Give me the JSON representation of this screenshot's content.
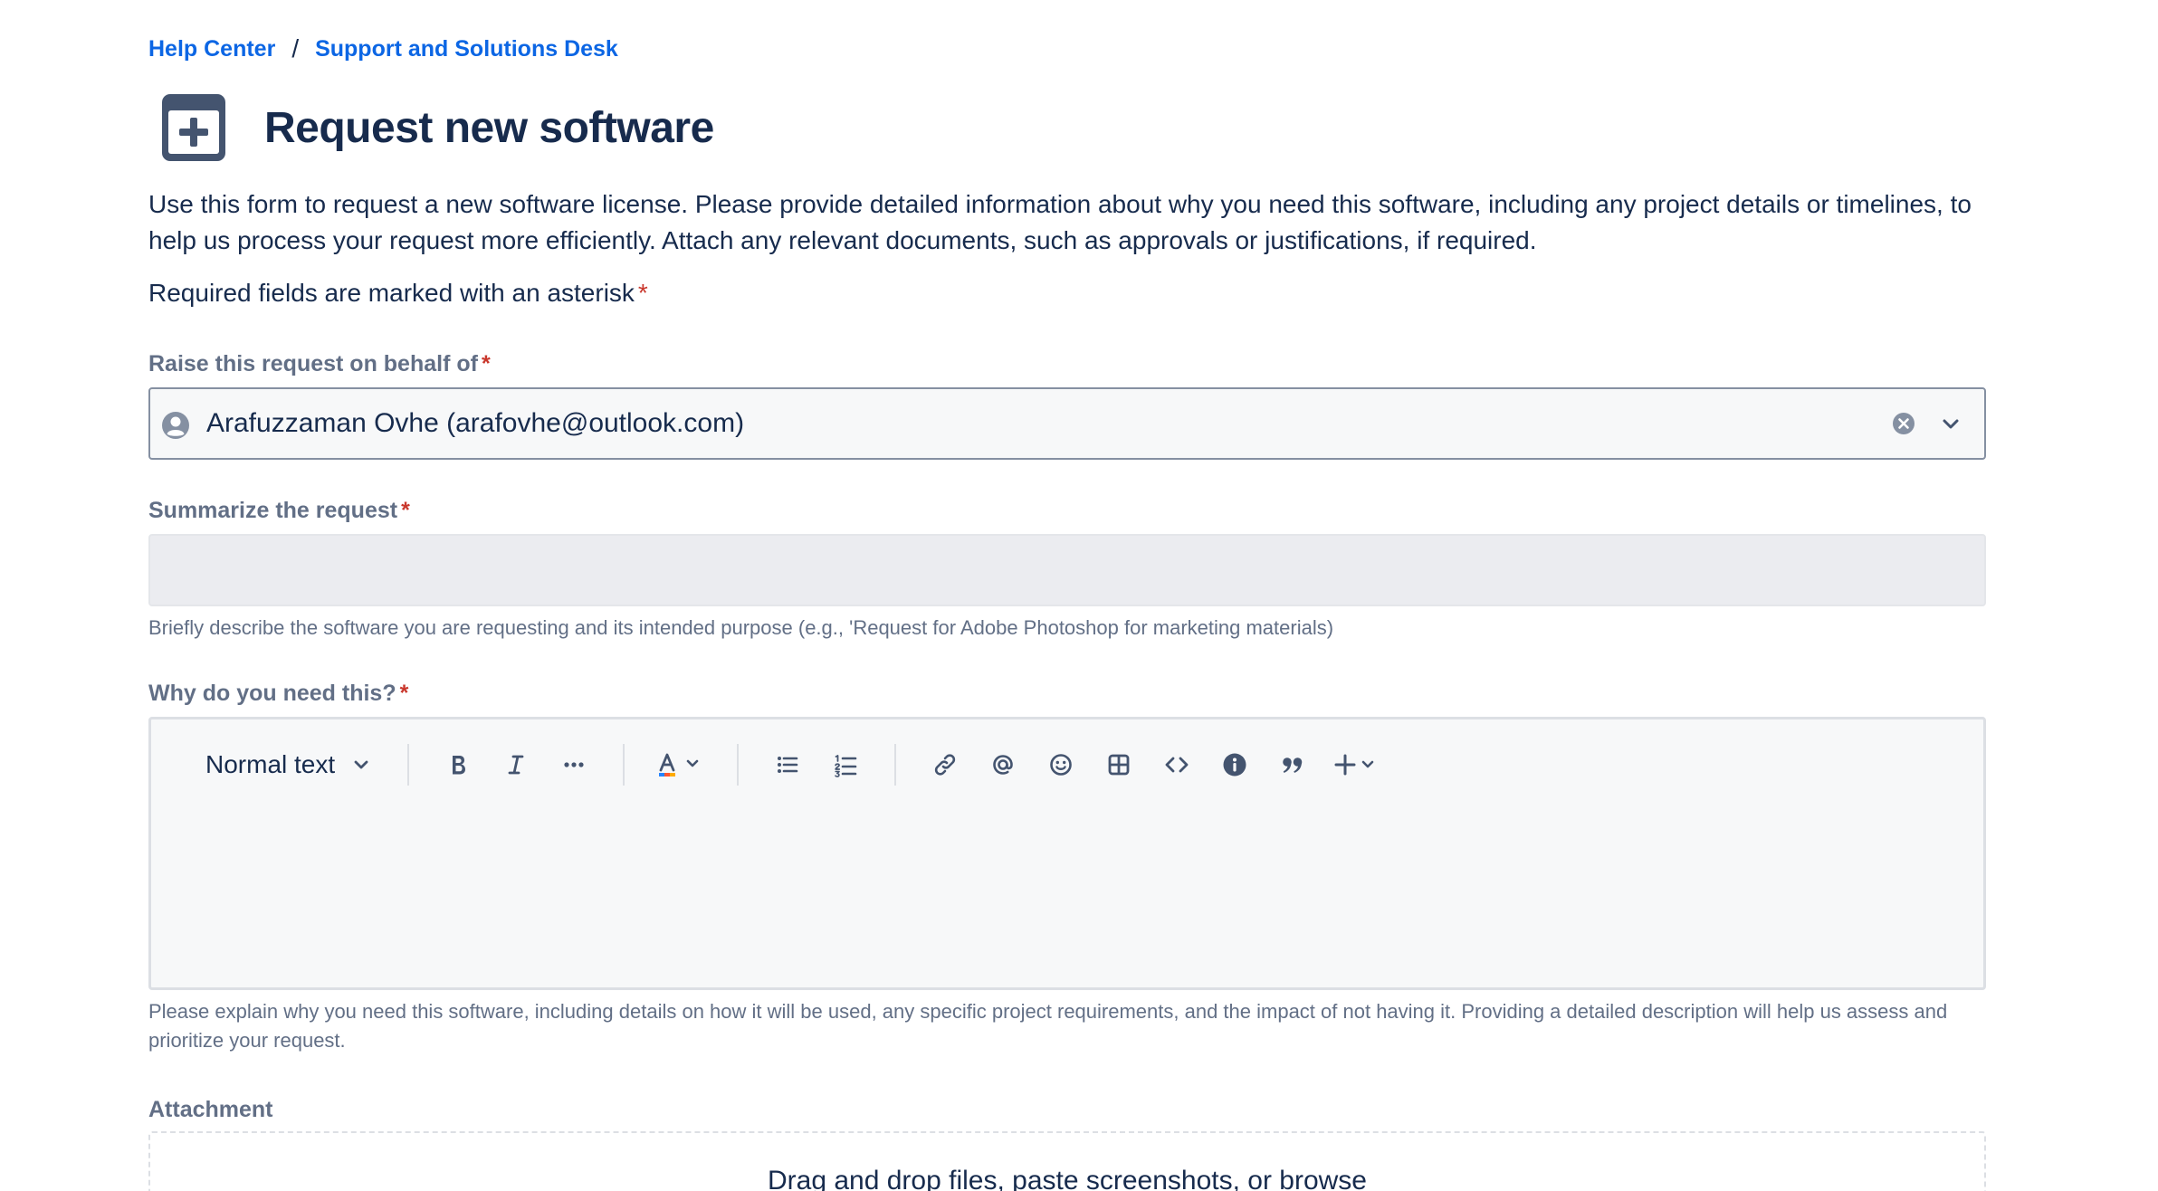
{
  "breadcrumb": {
    "home": "Help Center",
    "separator": "/",
    "desk": "Support and Solutions Desk"
  },
  "header": {
    "icon": "request-form-plus-icon",
    "title": "Request new software"
  },
  "description": "Use this form to request a new software license. Please provide detailed information about why you need this software, including any project details or timelines, to help us process your request more efficiently. Attach any relevant documents, such as approvals or justifications, if required.",
  "required_note": "Required fields are marked with an asterisk",
  "asterisk": "*",
  "fields": {
    "behalf": {
      "label": "Raise this request on behalf of",
      "value": "Arafuzzaman Ovhe (arafovhe@outlook.com)"
    },
    "summary": {
      "label": "Summarize the request",
      "value": "",
      "helper": "Briefly describe the software you are requesting and its intended purpose (e.g., 'Request for Adobe Photoshop for marketing materials)"
    },
    "why": {
      "label": "Why do you need this?",
      "text_style": "Normal text",
      "helper": "Please explain why you need this software, including details on how it will be used, any specific project requirements, and the impact of not having it. Providing a detailed description will help us assess and prioritize your request."
    },
    "attachment": {
      "label": "Attachment",
      "dropzone": "Drag and drop files, paste screenshots, or browse"
    }
  },
  "colors": {
    "link": "#0c66e4",
    "text": "#172b4d",
    "subtle_text": "#626f86",
    "required": "#c9372c",
    "border": "#8590a2"
  }
}
